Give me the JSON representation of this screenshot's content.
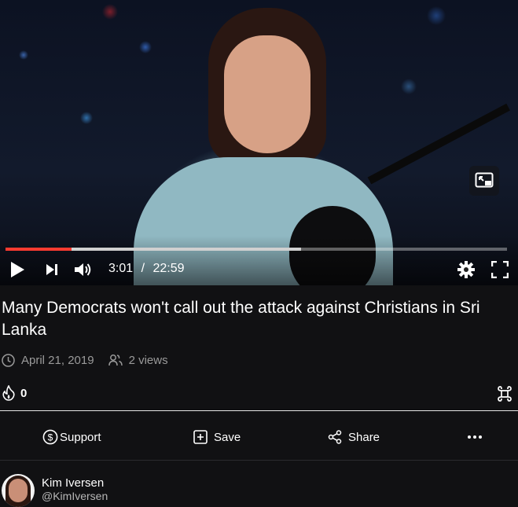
{
  "player": {
    "current_time": "3:01",
    "time_separator": "/",
    "duration": "22:59",
    "progress_fraction": 0.131,
    "buffered_fraction": 0.59,
    "icons": [
      "play-icon",
      "skip-next-icon",
      "volume-icon",
      "settings-gear-icon",
      "fullscreen-icon",
      "picture-in-picture-icon"
    ]
  },
  "video": {
    "title": "Many Democrats won't call out the attack against Christians in Sri Lanka",
    "date": "April 21, 2019",
    "views": "2 views",
    "rumbles_count": "0"
  },
  "actions": {
    "support_label": "Support",
    "save_label": "Save",
    "share_label": "Share"
  },
  "channel": {
    "name": "Kim Iversen",
    "handle": "@KimIversen"
  },
  "colors": {
    "background": "#111113",
    "progress_played": "#ff3b30",
    "text_secondary": "#9a9a9a"
  }
}
